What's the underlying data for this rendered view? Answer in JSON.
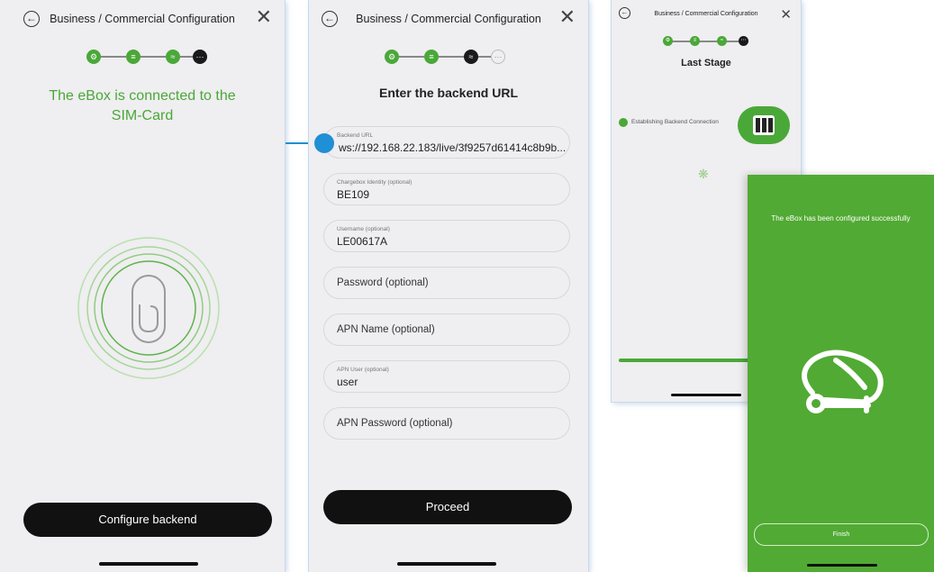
{
  "screen1": {
    "title": "Business / Commercial Configuration",
    "message": "The eBox is connected to the SIM-Card",
    "button": "Configure backend",
    "icons": [
      "back-arrow-icon",
      "close-icon",
      "gear-icon",
      "list-icon",
      "wifi-icon",
      "dots-icon",
      "sim-card-icon"
    ]
  },
  "screen2": {
    "title": "Business / Commercial Configuration",
    "heading": "Enter the backend URL",
    "fields": [
      {
        "label": "Backend URL",
        "value": "ws://192.168.22.183/live/3f9257d61414c8b9b..."
      },
      {
        "label": "Chargebox Identity (optional)",
        "value": "BE109"
      },
      {
        "label": "Username (optional)",
        "value": "LE00617A"
      },
      {
        "placeholder": "Password (optional)"
      },
      {
        "placeholder": "APN Name (optional)"
      },
      {
        "label": "APN User (optional)",
        "value": "user"
      },
      {
        "placeholder": "APN Password (optional)"
      }
    ],
    "button": "Proceed"
  },
  "screen3": {
    "title": "Business / Commercial Configuration",
    "heading": "Last Stage",
    "status": "Establishing Backend Connection",
    "progress": 0.7
  },
  "screen4": {
    "message": "The eBox has been configured successfully",
    "button": "Finish"
  },
  "colors": {
    "accent": "#4aa838",
    "success_bg": "#51aa33",
    "connector": "#1f8fd6",
    "dark": "#111111"
  }
}
